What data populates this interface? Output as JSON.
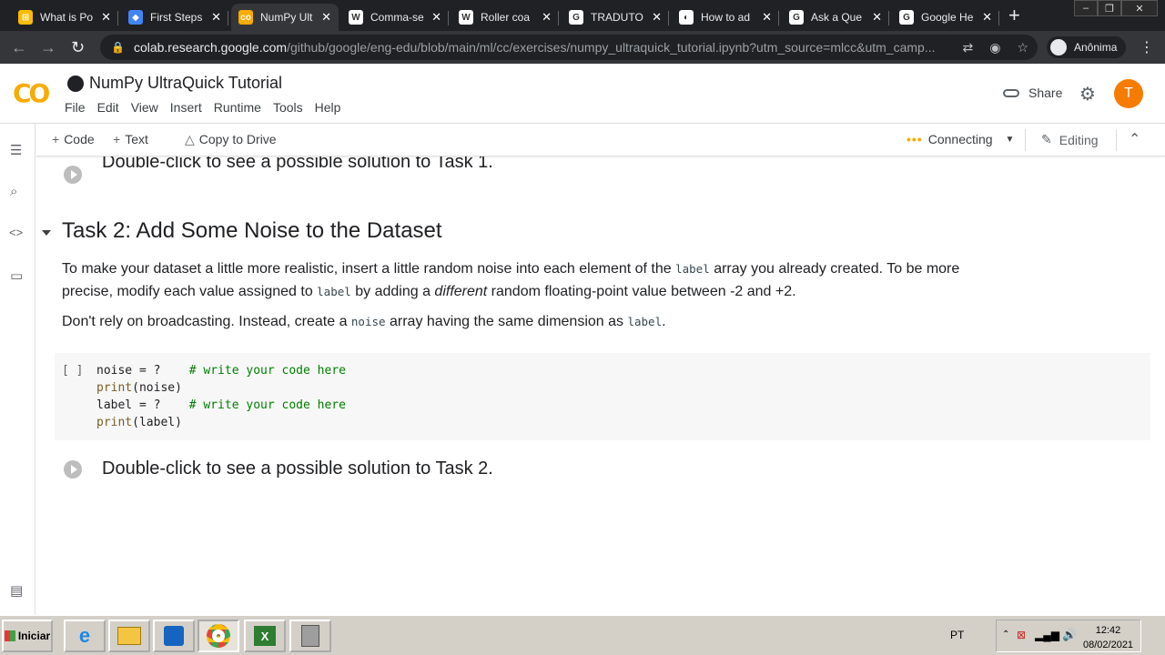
{
  "browser": {
    "tabs": [
      {
        "title": "What is Po",
        "fav_color": "#fbbc04",
        "fav_glyph": "⊞",
        "active": false
      },
      {
        "title": "First Steps",
        "fav_color": "#4285f4",
        "fav_glyph": "◆",
        "active": false
      },
      {
        "title": "NumPy Ult",
        "fav_color": "#f9ab00",
        "fav_glyph": "co",
        "active": true
      },
      {
        "title": "Comma-se",
        "fav_color": "#ffffff",
        "fav_glyph": "W",
        "active": false
      },
      {
        "title": "Roller coa",
        "fav_color": "#ffffff",
        "fav_glyph": "W",
        "active": false
      },
      {
        "title": "TRADUTO",
        "fav_color": "#ffffff",
        "fav_glyph": "G",
        "active": false
      },
      {
        "title": "How to ad",
        "fav_color": "#ffffff",
        "fav_glyph": "◐",
        "active": false
      },
      {
        "title": "Ask a Que",
        "fav_color": "#ffffff",
        "fav_glyph": "G",
        "active": false
      },
      {
        "title": "Google He",
        "fav_color": "#ffffff",
        "fav_glyph": "G",
        "active": false
      }
    ],
    "url_host": "colab.research.google.com",
    "url_path": "/github/google/eng-edu/blob/main/ml/cc/exercises/numpy_ultraquick_tutorial.ipynb?utm_source=mlcc&utm_camp...",
    "profile_label": "Anônima"
  },
  "colab": {
    "title": "NumPy UltraQuick Tutorial",
    "menu": [
      "File",
      "Edit",
      "View",
      "Insert",
      "Runtime",
      "Tools",
      "Help"
    ],
    "share_label": "Share",
    "avatar_letter": "T",
    "toolbar": {
      "code_label": "Code",
      "text_label": "Text",
      "drive_label": "Copy to Drive",
      "status_label": "Connecting",
      "editing_label": "Editing"
    }
  },
  "notebook": {
    "solution1": "Double-click to see a possible solution to Task 1.",
    "section_title": "Task 2: Add Some Noise to the Dataset",
    "para1_a": "To make your dataset a little more realistic, insert a little random noise into each element of the ",
    "para1_code1": "label",
    "para1_b": " array you already created. To be more precise, modify each value assigned to ",
    "para1_code2": "label",
    "para1_c": " by adding a ",
    "para1_em": "different",
    "para1_d": " random floating-point value between -2 and +2.",
    "para2_a": "Don't rely on broadcasting. Instead, create a ",
    "para2_code1": "noise",
    "para2_b": " array having the same dimension as ",
    "para2_code2": "label",
    "para2_c": ".",
    "code_bracket": "[ ]",
    "code": {
      "l1_code": "noise = ?    ",
      "l1_comment": "# write your code here",
      "l2_fn": "print",
      "l2_rest": "(noise)",
      "l3_code": "label = ?    ",
      "l3_comment": "# write your code here",
      "l4_fn": "print",
      "l4_rest": "(label)"
    },
    "solution2": "Double-click to see a possible solution to Task 2."
  },
  "taskbar": {
    "start_label": "Iniciar",
    "lang": "PT",
    "time": "12:42",
    "date": "08/02/2021"
  }
}
